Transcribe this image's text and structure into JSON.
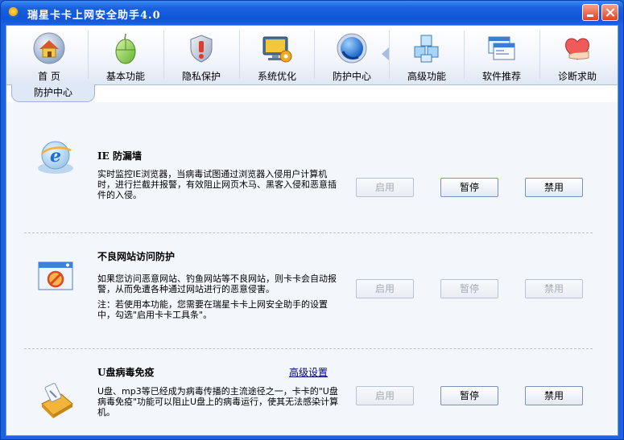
{
  "window": {
    "title": "瑞星卡卡上网安全助手4.0"
  },
  "nav": [
    {
      "label": "首 页",
      "icon": "home-icon"
    },
    {
      "label": "基本功能",
      "icon": "mouse-icon"
    },
    {
      "label": "隐私保护",
      "icon": "shield-icon"
    },
    {
      "label": "系统优化",
      "icon": "monitor-gear-icon"
    },
    {
      "label": "防护中心",
      "icon": "protection-globe-icon"
    },
    {
      "label": "高级功能",
      "icon": "cubes-icon"
    },
    {
      "label": "软件推荐",
      "icon": "windows-icon"
    },
    {
      "label": "诊断求助",
      "icon": "heart-hand-icon"
    }
  ],
  "tab": {
    "label": "防护中心"
  },
  "sections": [
    {
      "title": "IE 防漏墙",
      "desc": "实时监控IE浏览器，当病毒试图通过浏览器入侵用户计算机时，进行拦截并报警，有效阻止网页木马、黑客入侵和恶意插件的入侵。",
      "buttons": {
        "enable": "启用",
        "pause": "暂停",
        "disable": "禁用"
      }
    },
    {
      "title": "不良网站访问防护",
      "desc": "如果您访问恶意网站、钓鱼网站等不良网站，则卡卡会自动报警，从而免遭各种通过网站进行的恶意侵害。",
      "note": "注：若使用本功能，您需要在瑞星卡卡上网安全助手的设置中，勾选\"启用卡卡工具条\"。",
      "buttons": {
        "enable": "启用",
        "pause": "暂停",
        "disable": "禁用"
      }
    },
    {
      "title": "U盘病毒免疫",
      "link": "高级设置",
      "desc": "U盘、mp3等已经成为病毒传播的主流途径之一，卡卡的\"U盘病毒免疫\"功能可以阻止U盘上的病毒运行，使其无法感染计算机。",
      "buttons": {
        "enable": "启用",
        "pause": "暂停",
        "disable": "禁用"
      }
    }
  ]
}
